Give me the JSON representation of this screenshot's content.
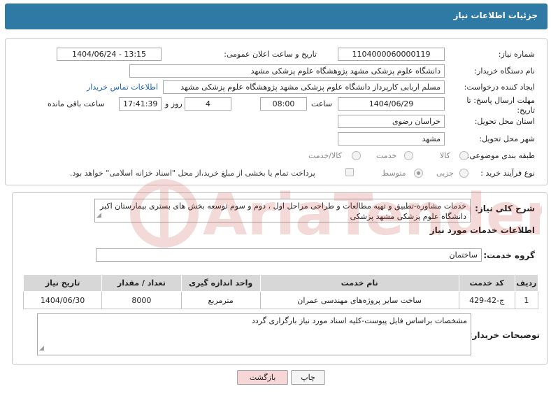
{
  "header": {
    "title": "جزئیات اطلاعات نیاز"
  },
  "form": {
    "need_number_label": "شماره نیاز:",
    "need_number": "1104000060000119",
    "announce_label": "تاریخ و ساعت اعلان عمومی:",
    "announce_value": "1404/06/24 - 13:15",
    "buyer_org_label": "نام دستگاه خریدار:",
    "buyer_org": "دانشگاه علوم پزشکی مشهد   پژوهشگاه علوم پزشکی مشهد",
    "creator_label": "ایجاد کننده درخواست:",
    "creator": "مسلم اربابی کارپرداز دانشگاه علوم پزشکی مشهد   پژوهشگاه علوم پزشکی مشهد",
    "contact_link": "اطلاعات تماس خریدار",
    "deadline_label_1": "مهلت ارسال پاسخ: تا",
    "deadline_label_2": "تاریخ:",
    "deadline_date": "1404/06/29",
    "time_label": "ساعت",
    "deadline_time": "08:00",
    "days_value": "4",
    "days_label": "روز و",
    "remaining_time": "17:41:39",
    "remaining_label": "ساعت باقی مانده",
    "province_label": "استان محل تحویل:",
    "province": "خراسان رضوی",
    "city_label": "شهر محل تحویل:",
    "city": "مشهد",
    "category_label": "طبقه بندی موضوعی:",
    "category_options": [
      "کالا",
      "خدمت",
      "کالا/خدمت"
    ],
    "process_label": "نوع فرآیند خرید :",
    "process_options": [
      "جزیی",
      "متوسط"
    ],
    "payment_note": "پرداخت تمام یا بخشی از مبلغ خرید،از محل \"اسناد خزانه اسلامی\" خواهد بود."
  },
  "summary": {
    "label": "شرح کلی نیاز:",
    "text": "خدمات مشاوره-تطبیق و تهیه مطالعات و طراحی مراحل اول ، دوم و سوم توسعه بخش های بستری بیمارستان اکبر دانشگاه علوم پزشکی مشهد پزشکی"
  },
  "services": {
    "section_title": "اطلاعات خدمات مورد نیاز",
    "group_label": "گروه خدمت:",
    "group_value": "ساختمان",
    "columns": [
      "ردیف",
      "کد خدمت",
      "نام خدمت",
      "واحد اندازه گیری",
      "تعداد / مقدار",
      "تاریخ نیاز"
    ],
    "rows": [
      [
        "1",
        "ج-42-429",
        "ساخت سایر پروژه‌های مهندسی عمران",
        "مترمربع",
        "8000",
        "1404/06/30"
      ]
    ]
  },
  "buyer_notes": {
    "label": "توضیحات خریدار:",
    "text": "مشخصات براساس فایل پیوست-کلیه اسناد مورد نیاز بارگزاری گردد"
  },
  "buttons": {
    "print": "چاپ",
    "back": "بازگشت"
  },
  "watermark": {
    "text": "AriaTender.neT"
  },
  "colors": {
    "header": "#2f7aa5",
    "link": "#1a5fa8",
    "back_button": "#f6d6d6"
  }
}
